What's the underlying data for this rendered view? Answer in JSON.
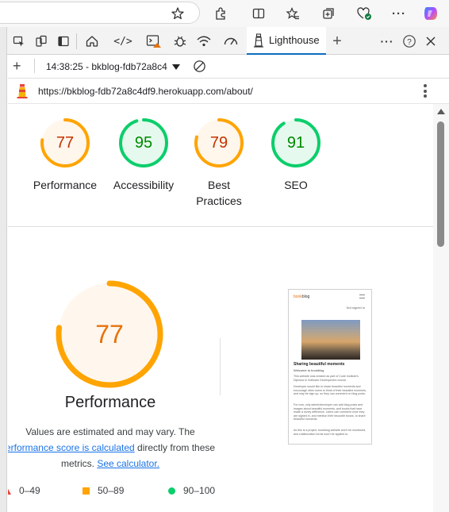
{
  "browser": {
    "icons": [
      "star-icon",
      "extensions-icon",
      "split-screen-icon",
      "favorites-icon",
      "collections-icon",
      "browser-essentials-icon",
      "more-icon",
      "copilot-icon"
    ]
  },
  "devtools": {
    "active_tab": "Lighthouse",
    "tools": [
      "inspect-icon",
      "device-toolbar-icon",
      "dock-icon",
      "welcome-icon",
      "elements-icon",
      "console-icon",
      "sources-icon",
      "network-icon",
      "performance-icon",
      "lighthouse-icon"
    ]
  },
  "toolbar": {
    "report_label": "14:38:25 - bkblog-fdb72a8c4"
  },
  "page": {
    "url": "https://bkblog-fdb72a8c4df9.herokuapp.com/about/"
  },
  "scores": [
    {
      "label": "Performance",
      "score": "77",
      "value": 77,
      "color": "#ffa400",
      "fill": "#fff6ec",
      "text": "#c33300"
    },
    {
      "label": "Accessibility",
      "score": "95",
      "value": 95,
      "color": "#0cce6b",
      "fill": "#e6f9ee",
      "text": "#008800"
    },
    {
      "label": "Best Practices",
      "score": "79",
      "value": 79,
      "color": "#ffa400",
      "fill": "#fff6ec",
      "text": "#c33300"
    },
    {
      "label": "SEO",
      "score": "91",
      "value": 91,
      "color": "#0cce6b",
      "fill": "#e6f9ee",
      "text": "#008800"
    }
  ],
  "performance": {
    "score": "77",
    "value": 77,
    "title": "Performance",
    "note_line1": "Values are estimated and may vary. The",
    "note_link": "erformance score is calculated",
    "note_mid": " directly from these",
    "note_line3": "metrics.",
    "calc_link": "See calculator."
  },
  "legend": {
    "fail": "0–49",
    "average": "50–89",
    "pass": "90–100"
  },
  "thumbnail": {
    "brand": "bookblog",
    "brand_prefix": "book",
    "brand_suffix": "blog",
    "signed": "Not signed in",
    "title": "Sharing beautiful moments",
    "subtitle": "Welcome to bookblog",
    "p1": "This website was created as part of Code Institute's Diploma in Software Development course.",
    "p2": "Developer would like to share beautiful moments and encourage other users to think of their beautiful moments, and may be sign up, so they can comment on blog posts.",
    "p3": "For now, only admin/developer can add blog posts and images about beautiful moments, and books that have made a lovely difference. Users can comment once they are signed in, and mention their favourite books, to share beautiful moments.",
    "p4": "As this is a project, bookblog website won't be monitored, and collaboration forms won't be applied to."
  }
}
